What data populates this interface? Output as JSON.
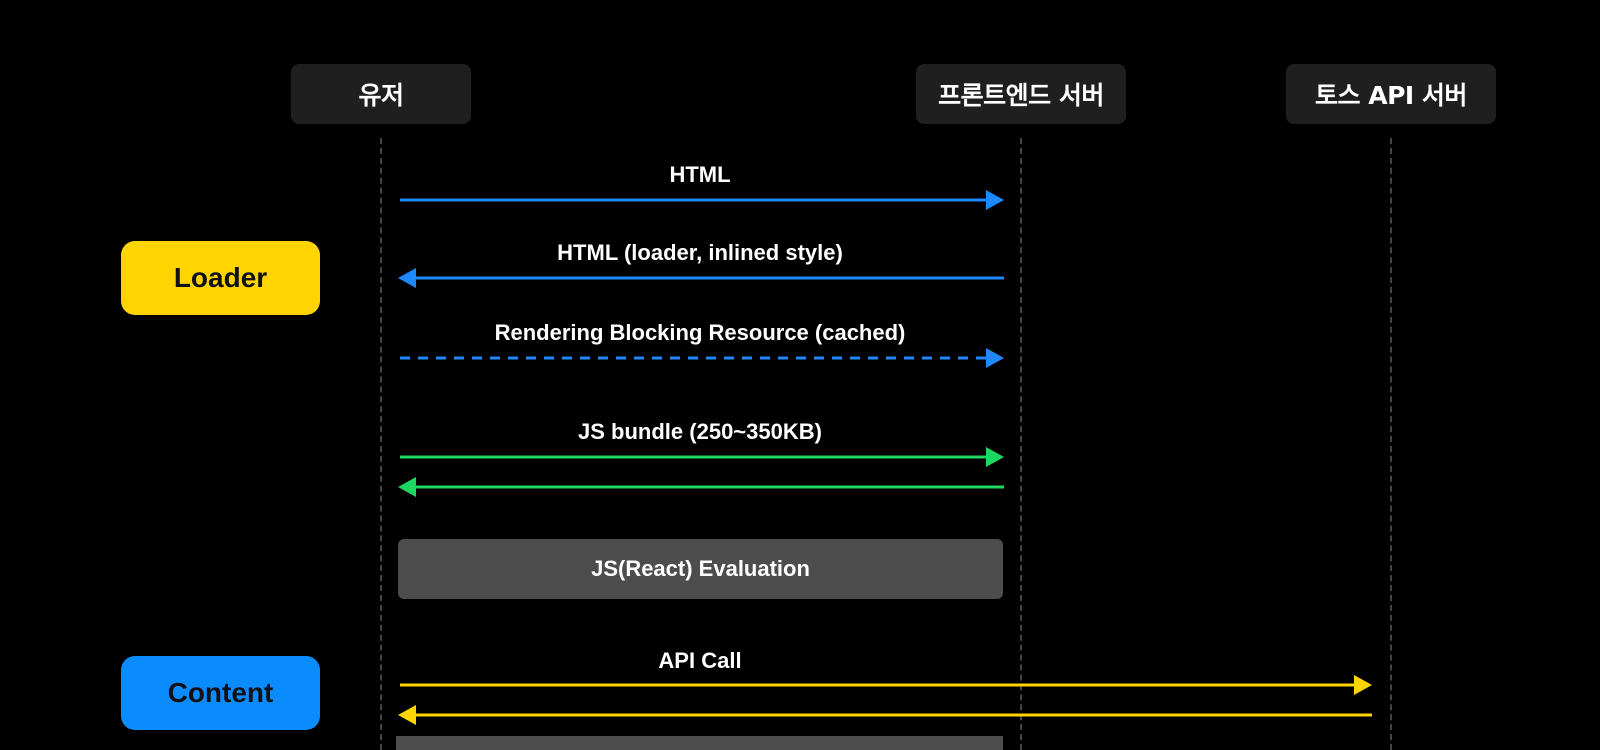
{
  "actors": {
    "user": "유저",
    "frontend": "프론트엔드 서버",
    "api": "토스 API 서버"
  },
  "phases": {
    "loader": "Loader",
    "content": "Content"
  },
  "messages": [
    {
      "label": "HTML",
      "from": "user",
      "to": "frontend",
      "style": "solid",
      "color": "#1e88ff"
    },
    {
      "label": "HTML (loader, inlined style)",
      "from": "frontend",
      "to": "user",
      "style": "solid",
      "color": "#1e88ff"
    },
    {
      "label": "Rendering Blocking Resource (cached)",
      "from": "user",
      "to": "frontend",
      "style": "dashed",
      "color": "#1e88ff"
    },
    {
      "label": "JS bundle (250~350KB)",
      "from": "user",
      "to": "frontend",
      "style": "solid",
      "color": "#1ed760"
    },
    {
      "label": "",
      "from": "frontend",
      "to": "user",
      "style": "solid",
      "color": "#1ed760"
    },
    {
      "label": "API Call",
      "from": "user",
      "to": "api",
      "style": "solid",
      "color": "#ffd400"
    },
    {
      "label": "",
      "from": "api",
      "to": "user",
      "style": "solid",
      "color": "#ffd400"
    }
  ],
  "evaluation": "JS(React) Evaluation",
  "colors": {
    "background": "#000000",
    "actor_box": "#1f1f1f",
    "lifeline": "#444444",
    "loader": "#ffd400",
    "content": "#0a8cff",
    "html_arrow": "#1e88ff",
    "js_arrow": "#1ed760",
    "api_arrow": "#ffd400",
    "evaluation_box": "#4d4d4d"
  }
}
